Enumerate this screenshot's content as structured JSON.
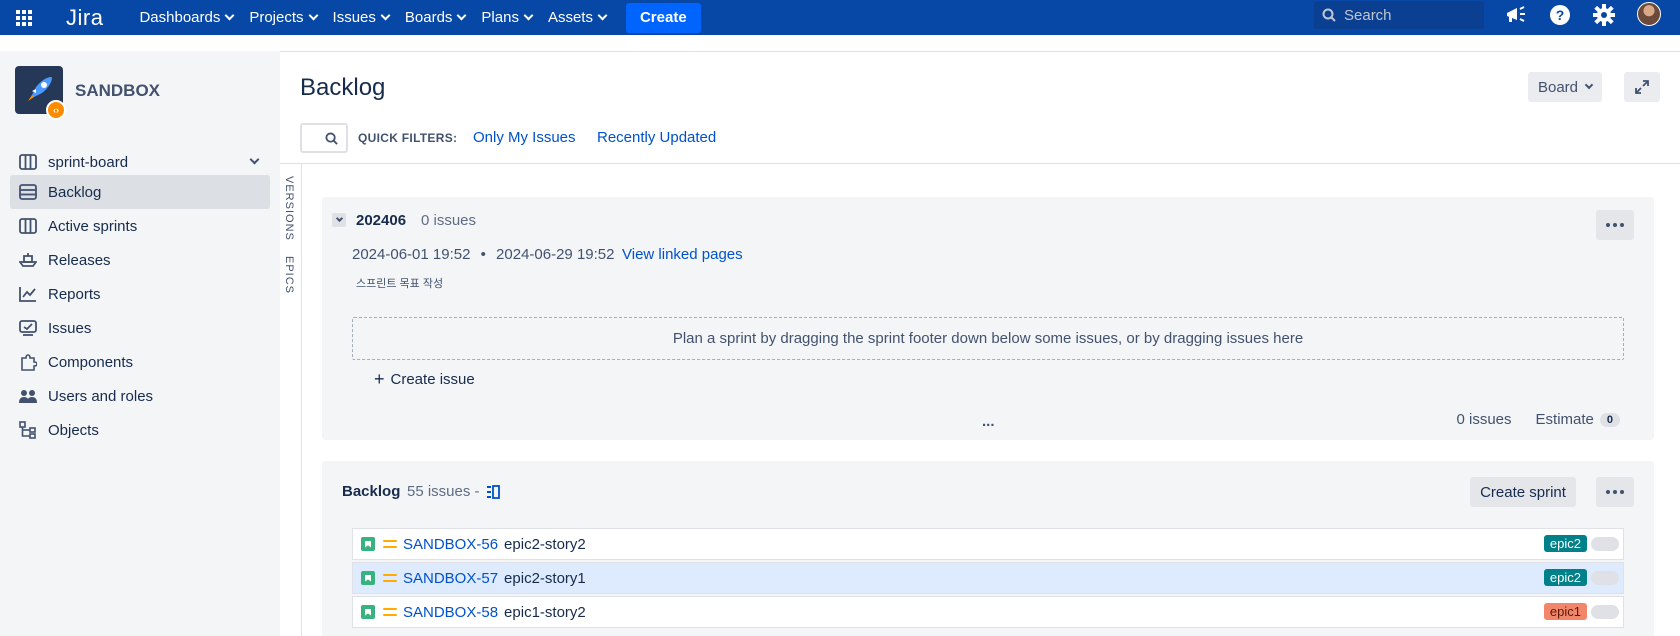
{
  "topnav": {
    "logo": "Jira",
    "items": [
      {
        "label": "Dashboards"
      },
      {
        "label": "Projects"
      },
      {
        "label": "Issues"
      },
      {
        "label": "Boards"
      },
      {
        "label": "Plans"
      },
      {
        "label": "Assets"
      }
    ],
    "create_label": "Create",
    "search_placeholder": "Search"
  },
  "sidebar": {
    "project_name": "SANDBOX",
    "board_selector": "sprint-board",
    "items": [
      {
        "label": "Backlog",
        "icon": "backlog-icon",
        "active": true
      },
      {
        "label": "Active sprints",
        "icon": "board-icon"
      },
      {
        "label": "Releases",
        "icon": "ship-icon"
      },
      {
        "label": "Reports",
        "icon": "chart-line-icon"
      },
      {
        "label": "Issues",
        "icon": "issues-icon"
      },
      {
        "label": "Components",
        "icon": "puzzle-icon"
      },
      {
        "label": "Users and roles",
        "icon": "people-icon"
      },
      {
        "label": "Objects",
        "icon": "tree-icon"
      }
    ]
  },
  "main": {
    "title": "Backlog",
    "board_button": "Board",
    "quick_filters_label": "QUICK FILTERS:",
    "quick_filters": [
      "Only My Issues",
      "Recently Updated"
    ],
    "vertical_tabs": [
      "VERSIONS",
      "EPICS"
    ]
  },
  "sprint": {
    "name": "202406",
    "count": "0 issues",
    "start": "2024-06-01 19:52",
    "separator": "•",
    "end": "2024-06-29 19:52",
    "link": "View linked pages",
    "goal": "스프린트 목표 작성",
    "dropzone_text": "Plan a sprint by dragging the sprint footer down below some issues, or by dragging issues here",
    "create_issue": "Create issue",
    "ellipsis": "...",
    "footer_count": "0 issues",
    "estimate_label": "Estimate",
    "estimate_value": "0"
  },
  "backlog": {
    "name": "Backlog",
    "count": "55 issues -",
    "create_sprint": "Create sprint",
    "issues": [
      {
        "key": "SANDBOX-56",
        "summary": "epic2-story2",
        "epic": "epic2",
        "epic_color": "#00818a"
      },
      {
        "key": "SANDBOX-57",
        "summary": "epic2-story1",
        "epic": "epic2",
        "epic_color": "#00818a",
        "selected": true
      },
      {
        "key": "SANDBOX-58",
        "summary": "epic1-story2",
        "epic": "epic1",
        "epic_color": "#f2866b"
      }
    ]
  }
}
